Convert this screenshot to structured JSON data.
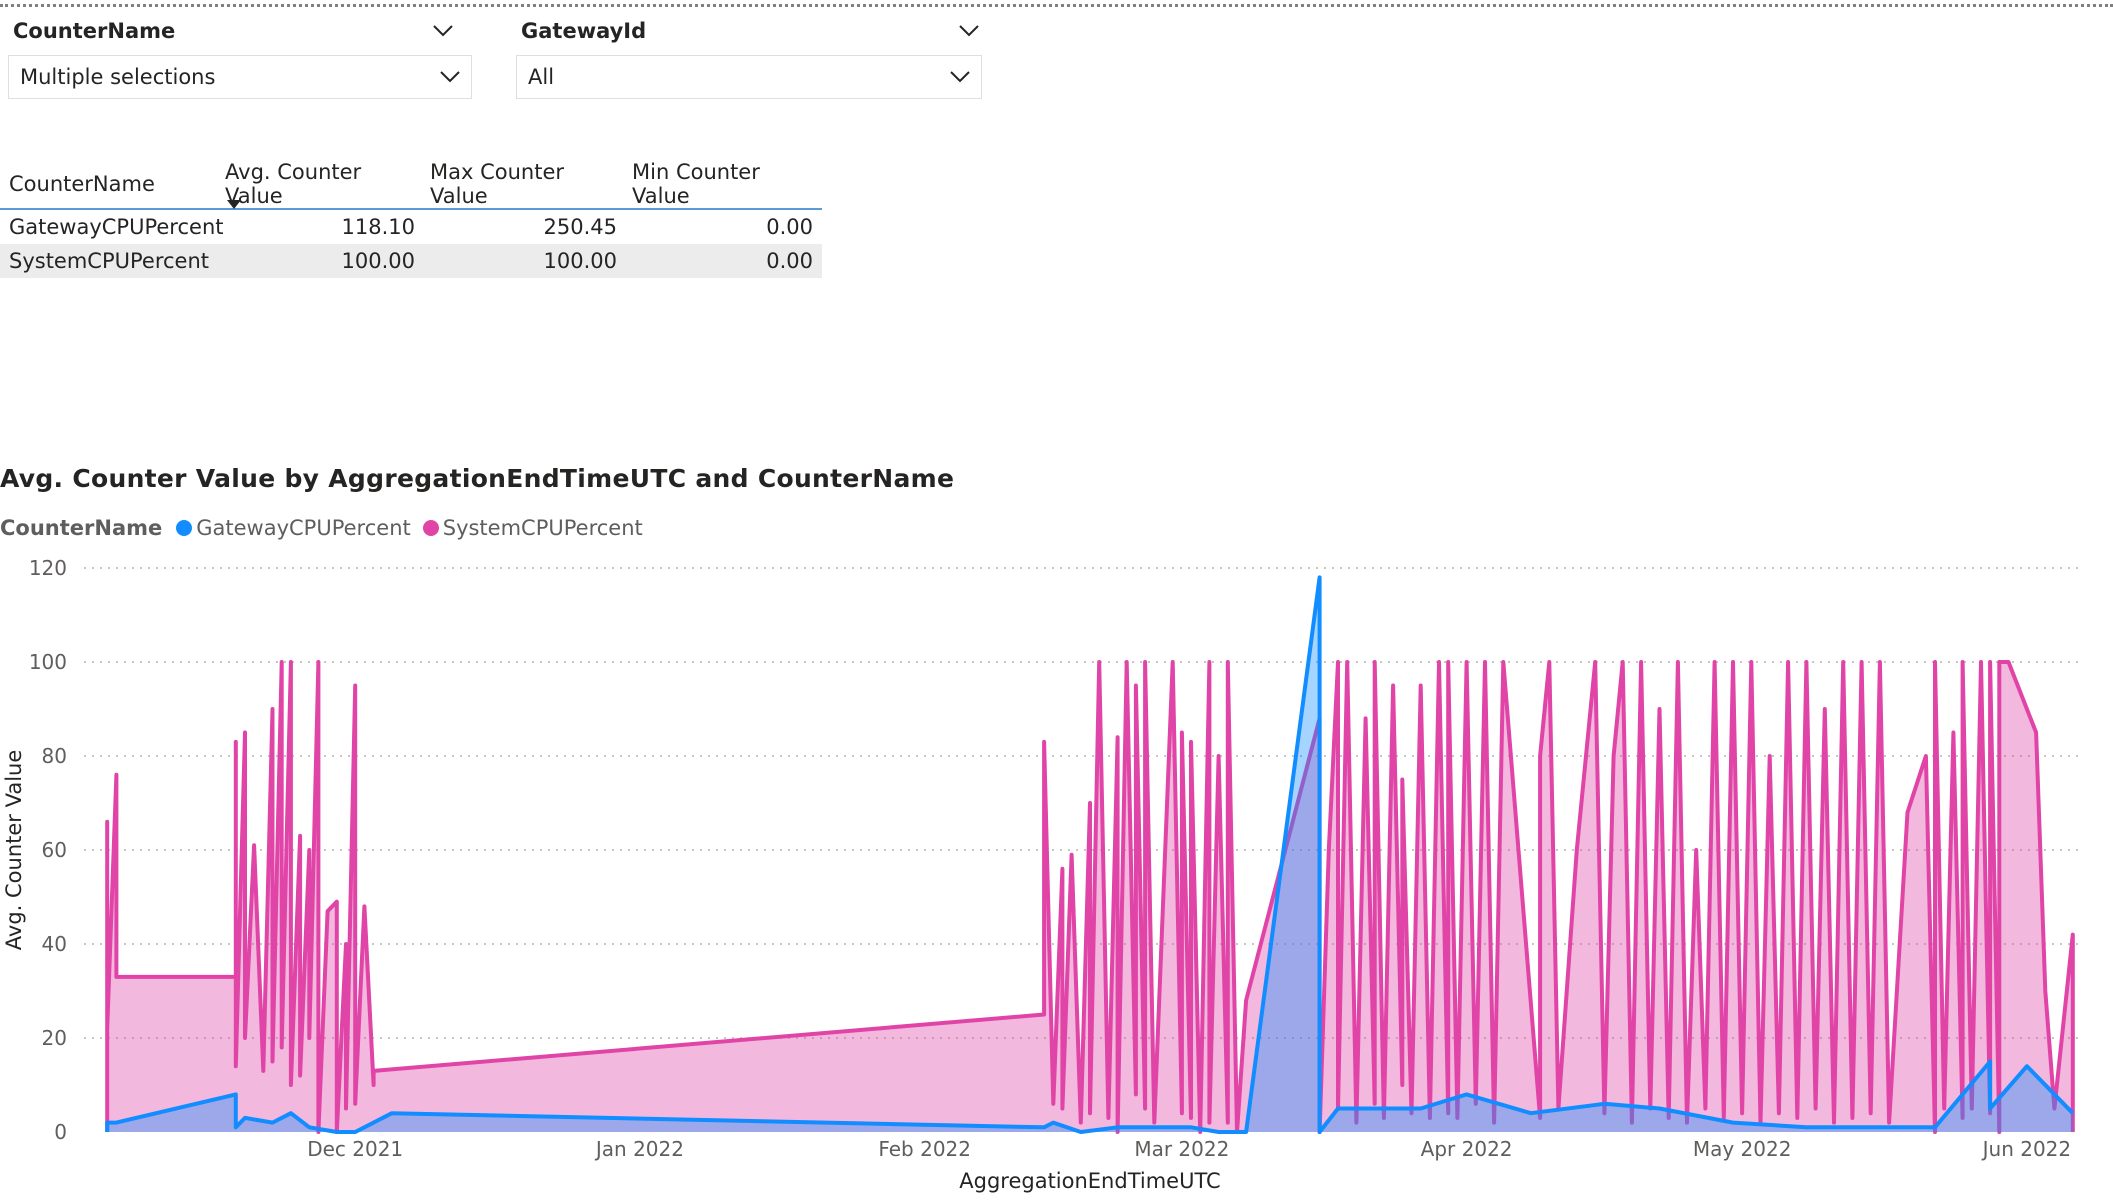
{
  "slicers": [
    {
      "title": "CounterName",
      "value": "Multiple selections"
    },
    {
      "title": "GatewayId",
      "value": "All"
    }
  ],
  "table": {
    "headers": [
      "CounterName",
      "Avg. Counter Value",
      "Max Counter Value",
      "Min Counter Value"
    ],
    "rows": [
      [
        "GatewayCPUPercent",
        "118.10",
        "250.45",
        "0.00"
      ],
      [
        "SystemCPUPercent",
        "100.00",
        "100.00",
        "0.00"
      ]
    ]
  },
  "chart_data": {
    "type": "area",
    "title": "Avg. Counter Value by AggregationEndTimeUTC and CounterName",
    "legend_title": "CounterName",
    "legend_position": "top-left",
    "xlabel": "AggregationEndTimeUTC",
    "ylabel": "Avg. Counter Value",
    "ylim": [
      0,
      120
    ],
    "yticks": [
      0,
      20,
      40,
      60,
      80,
      100,
      120
    ],
    "xticks": [
      "Dec 2021",
      "Jan 2022",
      "Feb 2022",
      "Mar 2022",
      "Apr 2022",
      "May 2022",
      "Jun 2022"
    ],
    "xlim": [
      "2021-11-03",
      "2022-06-07"
    ],
    "grid": true,
    "series": [
      {
        "name": "GatewayCPUPercent",
        "color": "#118dff",
        "points": [
          [
            "2021-11-04",
            0
          ],
          [
            "2021-11-04",
            2
          ],
          [
            "2021-11-05",
            2
          ],
          [
            "2021-11-18",
            8
          ],
          [
            "2021-11-18",
            1
          ],
          [
            "2021-11-19",
            3
          ],
          [
            "2021-11-22",
            2
          ],
          [
            "2021-11-24",
            4
          ],
          [
            "2021-11-26",
            1
          ],
          [
            "2021-11-29",
            0
          ],
          [
            "2021-12-01",
            0
          ],
          [
            "2021-12-02",
            1
          ],
          [
            "2021-12-05",
            4
          ],
          [
            "2022-02-14",
            1
          ],
          [
            "2022-02-15",
            2
          ],
          [
            "2022-02-18",
            0
          ],
          [
            "2022-02-22",
            1
          ],
          [
            "2022-03-02",
            1
          ],
          [
            "2022-03-05",
            0
          ],
          [
            "2022-03-08",
            0
          ],
          [
            "2022-03-16",
            118
          ],
          [
            "2022-03-16",
            0
          ],
          [
            "2022-03-18",
            5
          ],
          [
            "2022-03-27",
            5
          ],
          [
            "2022-04-01",
            8
          ],
          [
            "2022-04-08",
            4
          ],
          [
            "2022-04-16",
            6
          ],
          [
            "2022-04-22",
            5
          ],
          [
            "2022-04-30",
            2
          ],
          [
            "2022-05-08",
            1
          ],
          [
            "2022-05-22",
            1
          ],
          [
            "2022-05-28",
            15
          ],
          [
            "2022-05-28",
            5
          ],
          [
            "2022-06-01",
            14
          ],
          [
            "2022-06-06",
            4
          ]
        ]
      },
      {
        "name": "SystemCPUPercent",
        "color": "#e044a7",
        "points": [
          [
            "2021-11-04",
            0
          ],
          [
            "2021-11-04",
            66
          ],
          [
            "2021-11-04",
            22
          ],
          [
            "2021-11-05",
            76
          ],
          [
            "2021-11-05",
            45
          ],
          [
            "2021-11-05",
            33
          ],
          [
            "2021-11-18",
            33
          ],
          [
            "2021-11-18",
            83
          ],
          [
            "2021-11-18",
            14
          ],
          [
            "2021-11-19",
            85
          ],
          [
            "2021-11-19",
            20
          ],
          [
            "2021-11-20",
            61
          ],
          [
            "2021-11-21",
            13
          ],
          [
            "2021-11-22",
            90
          ],
          [
            "2021-11-22",
            15
          ],
          [
            "2021-11-23",
            100
          ],
          [
            "2021-11-23",
            18
          ],
          [
            "2021-11-24",
            100
          ],
          [
            "2021-11-24",
            10
          ],
          [
            "2021-11-25",
            63
          ],
          [
            "2021-11-25",
            12
          ],
          [
            "2021-11-26",
            60
          ],
          [
            "2021-11-26",
            20
          ],
          [
            "2021-11-27",
            100
          ],
          [
            "2021-11-27",
            0
          ],
          [
            "2021-11-28",
            47
          ],
          [
            "2021-11-29",
            49
          ],
          [
            "2021-11-29",
            0
          ],
          [
            "2021-11-30",
            40
          ],
          [
            "2021-11-30",
            5
          ],
          [
            "2021-12-01",
            95
          ],
          [
            "2021-12-01",
            6
          ],
          [
            "2021-12-02",
            48
          ],
          [
            "2021-12-03",
            10
          ],
          [
            "2021-12-03",
            13
          ],
          [
            "2022-02-14",
            25
          ],
          [
            "2022-02-14",
            83
          ],
          [
            "2022-02-15",
            6
          ],
          [
            "2022-02-16",
            56
          ],
          [
            "2022-02-16",
            5
          ],
          [
            "2022-02-17",
            59
          ],
          [
            "2022-02-18",
            2
          ],
          [
            "2022-02-19",
            70
          ],
          [
            "2022-02-19",
            4
          ],
          [
            "2022-02-20",
            100
          ],
          [
            "2022-02-21",
            3
          ],
          [
            "2022-02-22",
            84
          ],
          [
            "2022-02-22",
            0
          ],
          [
            "2022-02-23",
            100
          ],
          [
            "2022-02-24",
            8
          ],
          [
            "2022-02-24",
            95
          ],
          [
            "2022-02-25",
            5
          ],
          [
            "2022-02-25",
            100
          ],
          [
            "2022-02-26",
            2
          ],
          [
            "2022-02-28",
            100
          ],
          [
            "2022-03-01",
            4
          ],
          [
            "2022-03-01",
            85
          ],
          [
            "2022-03-02",
            3
          ],
          [
            "2022-03-02",
            83
          ],
          [
            "2022-03-03",
            0
          ],
          [
            "2022-03-04",
            100
          ],
          [
            "2022-03-04",
            2
          ],
          [
            "2022-03-05",
            80
          ],
          [
            "2022-03-06",
            2
          ],
          [
            "2022-03-06",
            100
          ],
          [
            "2022-03-07",
            0
          ],
          [
            "2022-03-08",
            28
          ],
          [
            "2022-03-16",
            88
          ],
          [
            "2022-03-16",
            0
          ],
          [
            "2022-03-17",
            60
          ],
          [
            "2022-03-18",
            100
          ],
          [
            "2022-03-18",
            5
          ],
          [
            "2022-03-19",
            100
          ],
          [
            "2022-03-20",
            2
          ],
          [
            "2022-03-21",
            88
          ],
          [
            "2022-03-22",
            6
          ],
          [
            "2022-03-22",
            100
          ],
          [
            "2022-03-23",
            3
          ],
          [
            "2022-03-24",
            95
          ],
          [
            "2022-03-25",
            10
          ],
          [
            "2022-03-25",
            75
          ],
          [
            "2022-03-26",
            4
          ],
          [
            "2022-03-27",
            95
          ],
          [
            "2022-03-28",
            3
          ],
          [
            "2022-03-29",
            100
          ],
          [
            "2022-03-30",
            4
          ],
          [
            "2022-03-30",
            100
          ],
          [
            "2022-03-31",
            3
          ],
          [
            "2022-04-01",
            100
          ],
          [
            "2022-04-02",
            6
          ],
          [
            "2022-04-03",
            100
          ],
          [
            "2022-04-04",
            2
          ],
          [
            "2022-04-05",
            100
          ],
          [
            "2022-04-09",
            3
          ],
          [
            "2022-04-09",
            80
          ],
          [
            "2022-04-10",
            100
          ],
          [
            "2022-04-11",
            5
          ],
          [
            "2022-04-13",
            60
          ],
          [
            "2022-04-15",
            100
          ],
          [
            "2022-04-16",
            4
          ],
          [
            "2022-04-17",
            80
          ],
          [
            "2022-04-18",
            100
          ],
          [
            "2022-04-19",
            2
          ],
          [
            "2022-04-20",
            100
          ],
          [
            "2022-04-21",
            5
          ],
          [
            "2022-04-22",
            90
          ],
          [
            "2022-04-23",
            3
          ],
          [
            "2022-04-24",
            100
          ],
          [
            "2022-04-25",
            2
          ],
          [
            "2022-04-26",
            60
          ],
          [
            "2022-04-27",
            5
          ],
          [
            "2022-04-28",
            100
          ],
          [
            "2022-04-29",
            3
          ],
          [
            "2022-04-30",
            100
          ],
          [
            "2022-05-01",
            4
          ],
          [
            "2022-05-02",
            100
          ],
          [
            "2022-05-03",
            2
          ],
          [
            "2022-05-04",
            80
          ],
          [
            "2022-05-05",
            4
          ],
          [
            "2022-05-06",
            100
          ],
          [
            "2022-05-07",
            3
          ],
          [
            "2022-05-08",
            100
          ],
          [
            "2022-05-09",
            5
          ],
          [
            "2022-05-10",
            90
          ],
          [
            "2022-05-11",
            2
          ],
          [
            "2022-05-12",
            100
          ],
          [
            "2022-05-13",
            3
          ],
          [
            "2022-05-14",
            100
          ],
          [
            "2022-05-15",
            4
          ],
          [
            "2022-05-16",
            100
          ],
          [
            "2022-05-17",
            2
          ],
          [
            "2022-05-19",
            68
          ],
          [
            "2022-05-21",
            80
          ],
          [
            "2022-05-22",
            0
          ],
          [
            "2022-05-22",
            100
          ],
          [
            "2022-05-23",
            5
          ],
          [
            "2022-05-24",
            85
          ],
          [
            "2022-05-25",
            3
          ],
          [
            "2022-05-25",
            100
          ],
          [
            "2022-05-26",
            5
          ],
          [
            "2022-05-27",
            100
          ],
          [
            "2022-05-28",
            4
          ],
          [
            "2022-05-28",
            100
          ],
          [
            "2022-05-29",
            0
          ],
          [
            "2022-05-29",
            100
          ],
          [
            "2022-05-30",
            100
          ],
          [
            "2022-06-02",
            85
          ],
          [
            "2022-06-03",
            30
          ],
          [
            "2022-06-04",
            5
          ],
          [
            "2022-06-06",
            42
          ],
          [
            "2022-06-06",
            0
          ]
        ]
      }
    ]
  }
}
